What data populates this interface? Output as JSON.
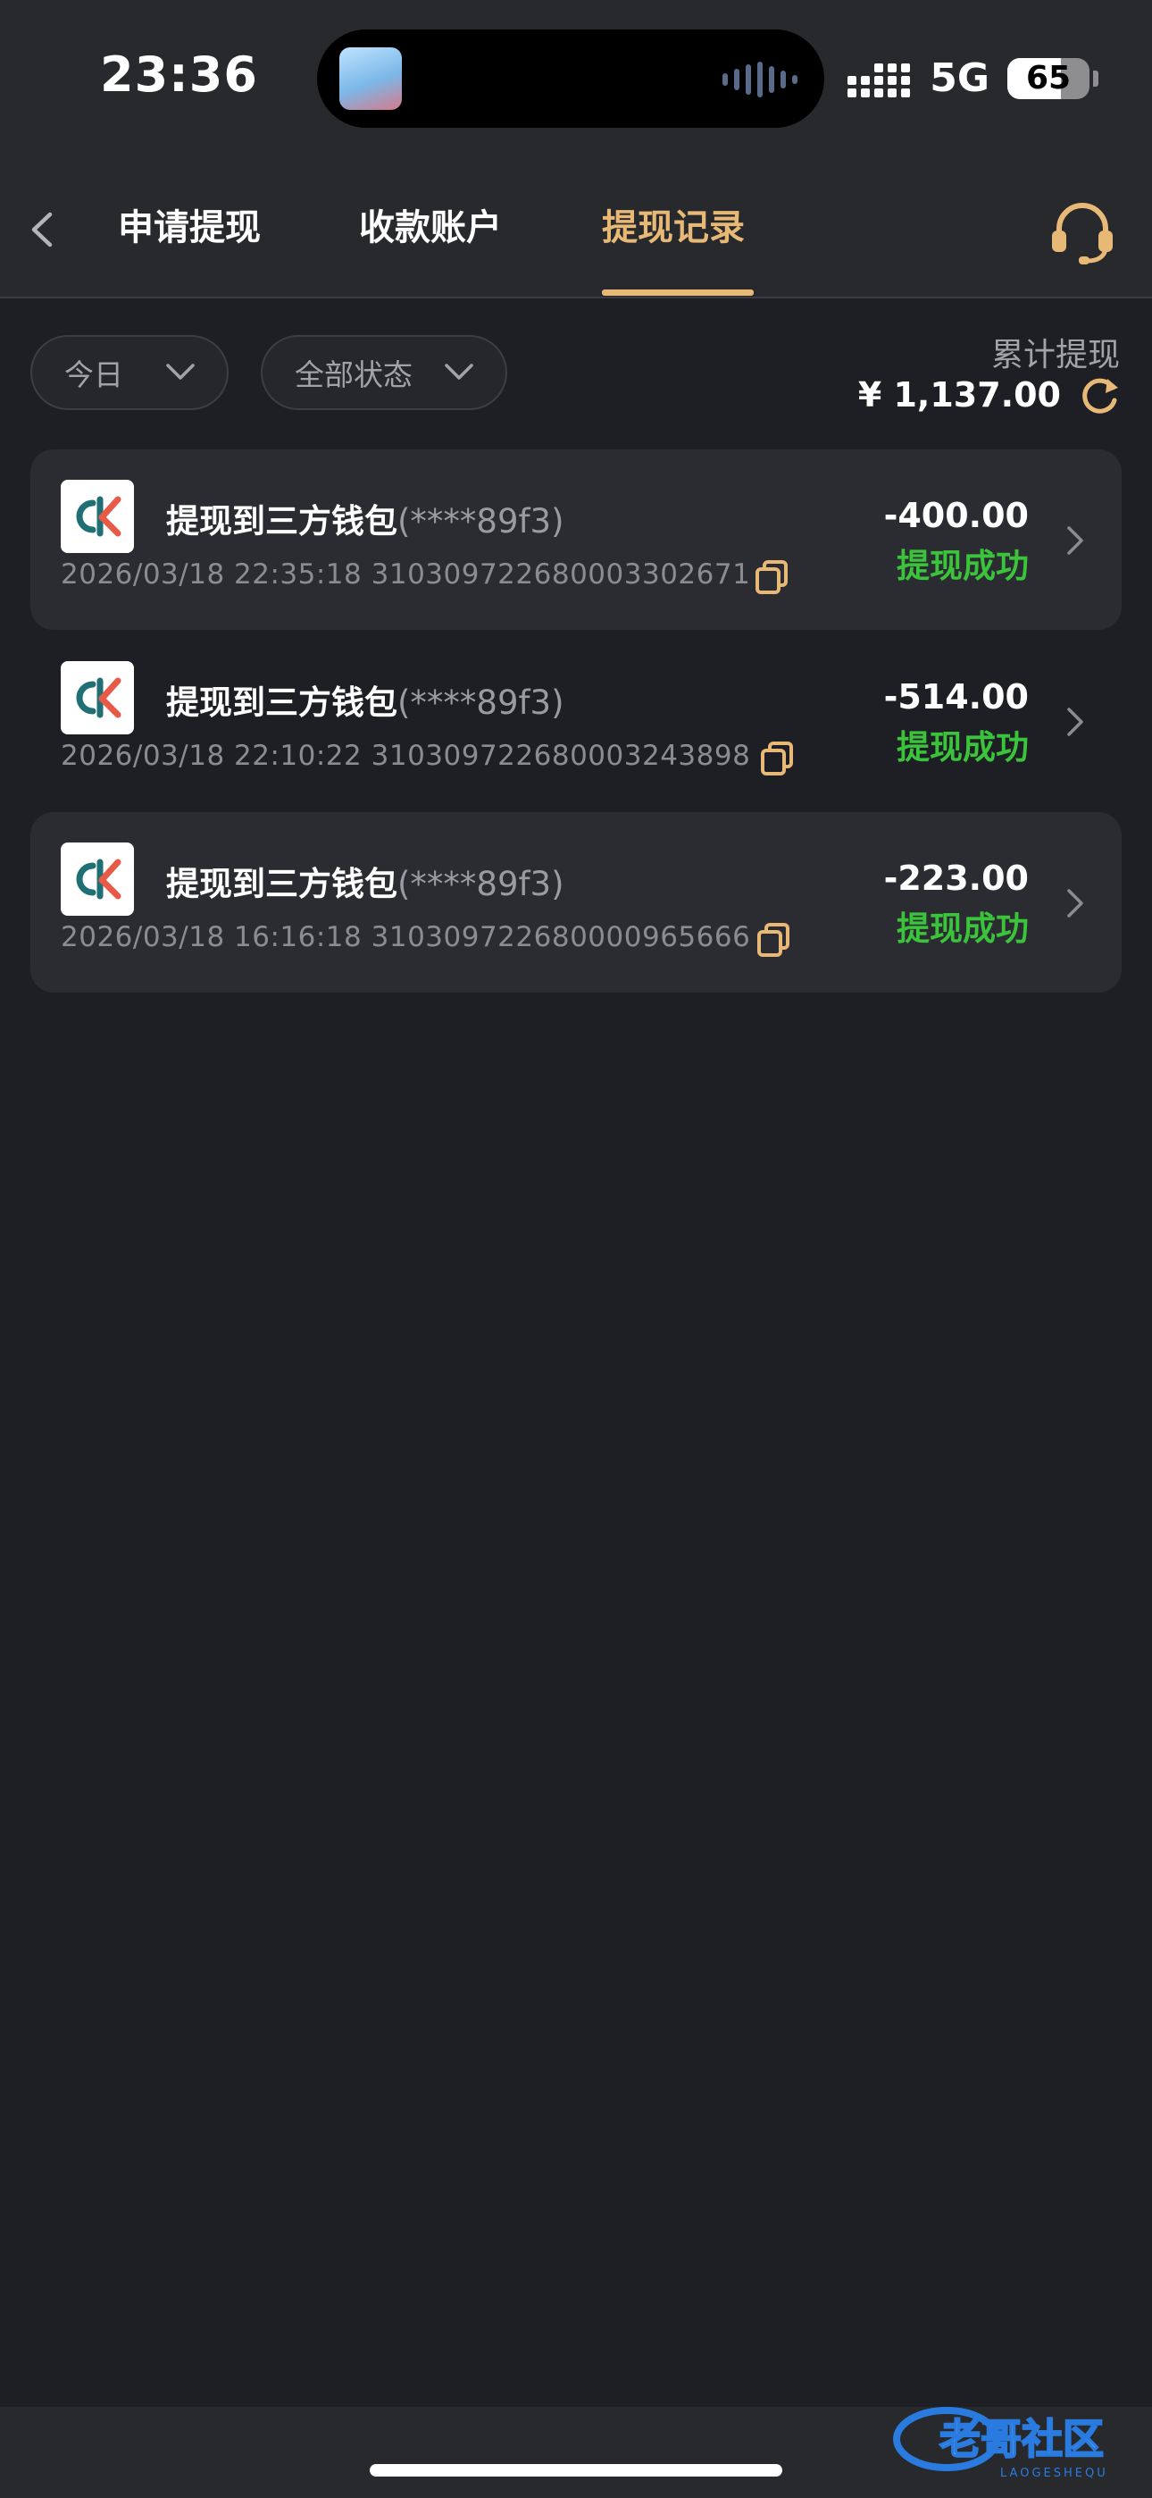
{
  "status_bar": {
    "time": "23:36",
    "network": "5G",
    "battery": "65",
    "battery_level": 0.65
  },
  "header": {
    "back_icon": "chevron-left-icon",
    "tabs": [
      {
        "label": "申请提现",
        "active": false
      },
      {
        "label": "收款账户",
        "active": false
      },
      {
        "label": "提现记录",
        "active": true
      }
    ],
    "support_icon": "headset-icon"
  },
  "filters": {
    "date": "今日",
    "status": "全部状态"
  },
  "summary": {
    "label": "累计提现",
    "value": "¥ 1,137.00"
  },
  "records": [
    {
      "title": "提现到三方钱包",
      "account": "(****89f3)",
      "datetime": "2026/03/18 22:35:18",
      "order_no": "310309722680003302671",
      "amount": "-400.00",
      "status": "提现成功"
    },
    {
      "title": "提现到三方钱包",
      "account": "(****89f3)",
      "datetime": "2026/03/18 22:10:22",
      "order_no": "310309722680003243898",
      "amount": "-514.00",
      "status": "提现成功"
    },
    {
      "title": "提现到三方钱包",
      "account": "(****89f3)",
      "datetime": "2026/03/18 16:16:18",
      "order_no": "310309722680000965666",
      "amount": "-223.00",
      "status": "提现成功"
    }
  ],
  "colors": {
    "accent": "#e8b877",
    "success": "#3bc43b",
    "background": "#1e1f24",
    "card": "#2b2c31"
  },
  "watermark": {
    "logo": "老哥社区",
    "sub": "LAOGESHEQU"
  }
}
